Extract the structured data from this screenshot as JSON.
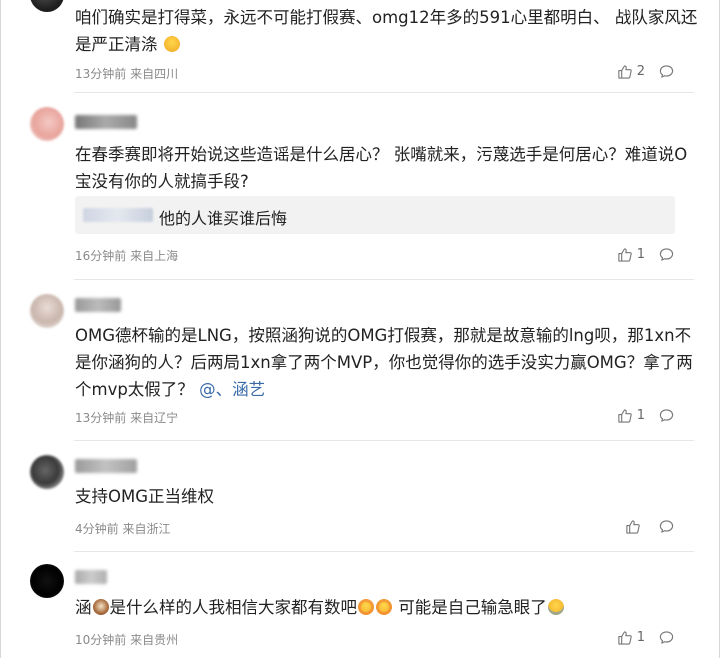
{
  "comments": [
    {
      "text": "咱们确实是打得菜，永远不可能打假赛、omg12年多的591心里都明白、 战队家风还是严正清涤",
      "meta": "13分钟前 来自四川",
      "likes": "2"
    },
    {
      "username": "",
      "text": "在春季赛即将开始说这些造谣是什么居心？ 张嘴就来，污蔑选手是何居心？难道说O宝没有你的人就搞手段?",
      "quote": "他的人谁买谁后悔",
      "meta": "16分钟前 来自上海",
      "likes": "1"
    },
    {
      "username": "",
      "text": "OMG德杯输的是LNG，按照涵狗说的OMG打假赛，那就是故意输的lng呗，那1xn不是你涵狗的人？后两局1xn拿了两个MVP，你也觉得你的选手没实力赢OMG？拿了两个mvp太假了？",
      "mention": "@、涵艺",
      "meta": "13分钟前 来自辽宁",
      "likes": "1"
    },
    {
      "username": "",
      "text": "支持OMG正当维权",
      "meta": "4分钟前 来自浙江",
      "likes": ""
    },
    {
      "username": "",
      "text_a": "涵",
      "text_b": "是什么样的人我相信大家都有数吧",
      "text_c": " 可能是自己输急眼了",
      "meta": "10分钟前 来自贵州",
      "likes": "1"
    }
  ],
  "colors": {
    "text": "#222222",
    "meta": "#8a8a8a",
    "mention": "#3a6aa8",
    "quote_bg": "#f2f2f2"
  },
  "icons": [
    "thumbs-up-icon",
    "comment-bubble-icon",
    "emoji-face-icon"
  ]
}
